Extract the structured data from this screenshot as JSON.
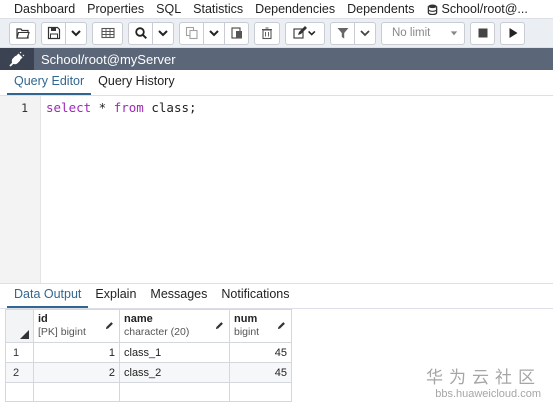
{
  "top_tabs": [
    "Dashboard",
    "Properties",
    "SQL",
    "Statistics",
    "Dependencies",
    "Dependents"
  ],
  "top_tab_last": "School/root@...",
  "toolbar": {
    "limit_value": "No limit",
    "icons": [
      "open-file-icon",
      "save-icon",
      "chevron-down-icon",
      "dropdown-icon",
      "search-icon",
      "copy-icon",
      "paste-icon",
      "delete-icon",
      "edit-icon",
      "filter-icon",
      "stop-icon",
      "execute-icon"
    ]
  },
  "connection": {
    "title": "School/root@myServer"
  },
  "editor_tabs": [
    "Query Editor",
    "Query History"
  ],
  "editor": {
    "line_number": "1",
    "tokens": {
      "select": "select",
      "star": " * ",
      "from": "from",
      "table": " class;"
    }
  },
  "output_tabs": [
    "Data Output",
    "Explain",
    "Messages",
    "Notifications"
  ],
  "grid": {
    "columns": [
      {
        "name": "id",
        "type": "[PK] bigint"
      },
      {
        "name": "name",
        "type": "character (20)"
      },
      {
        "name": "num",
        "type": "bigint"
      }
    ],
    "rows": [
      {
        "row": "1",
        "id": "1",
        "name": "class_1",
        "num": "45"
      },
      {
        "row": "2",
        "id": "2",
        "name": "class_2",
        "num": "45"
      }
    ]
  },
  "watermark": {
    "cn": "华为云社区",
    "url": "bbs.huaweicloud.com"
  },
  "colors": {
    "accent": "#326690",
    "keyword": "#9b2bb3",
    "connection_bar": "#5b6678"
  }
}
